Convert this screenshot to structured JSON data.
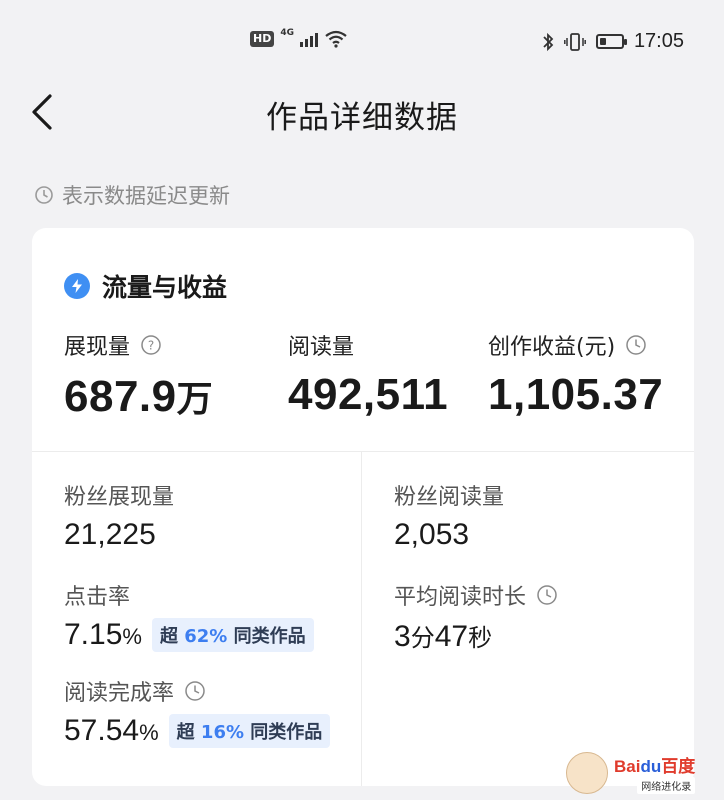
{
  "status_bar": {
    "hd": "HD",
    "network": "4G",
    "time": "17:05",
    "battery_level": 0.3
  },
  "header": {
    "back_icon": "chevron-left-icon",
    "title": "作品详细数据"
  },
  "delay_note": {
    "icon": "clock-icon",
    "text": "表示数据延迟更新"
  },
  "traffic": {
    "section_title": "流量与收益",
    "section_icon": "lightning-drop-icon",
    "metrics": [
      {
        "label": "展现量",
        "value": "687.9",
        "unit": "万",
        "icon": "help-icon"
      },
      {
        "label": "阅读量",
        "value": "492,511"
      },
      {
        "label": "创作收益(元)",
        "value": "1,105.37",
        "icon": "clock-icon"
      }
    ],
    "stats": {
      "fan_impressions": {
        "label": "粉丝展现量",
        "value": "21,225"
      },
      "fan_reads": {
        "label": "粉丝阅读量",
        "value": "2,053"
      },
      "ctr": {
        "label": "点击率",
        "value": "7.15",
        "unit": "%",
        "badge_pre": "超",
        "badge_pct": "62%",
        "badge_post": "同类作品"
      },
      "avg_read_time": {
        "label": "平均阅读时长",
        "min": "3",
        "min_unit": "分",
        "sec": "47",
        "sec_unit": "秒",
        "icon": "clock-icon"
      },
      "completion": {
        "label": "阅读完成率",
        "value": "57.54",
        "unit": "%",
        "badge_pre": "超",
        "badge_pct": "16%",
        "badge_post": "同类作品",
        "icon": "clock-icon"
      }
    }
  },
  "watermark": {
    "logo_left": "Bai",
    "logo_mid": "du",
    "logo_right": "百度",
    "sub": "网络进化录"
  },
  "colors": {
    "accent": "#3d7ef0",
    "badge_bg": "#e8f0fd",
    "page_bg": "#f2f2f4"
  }
}
